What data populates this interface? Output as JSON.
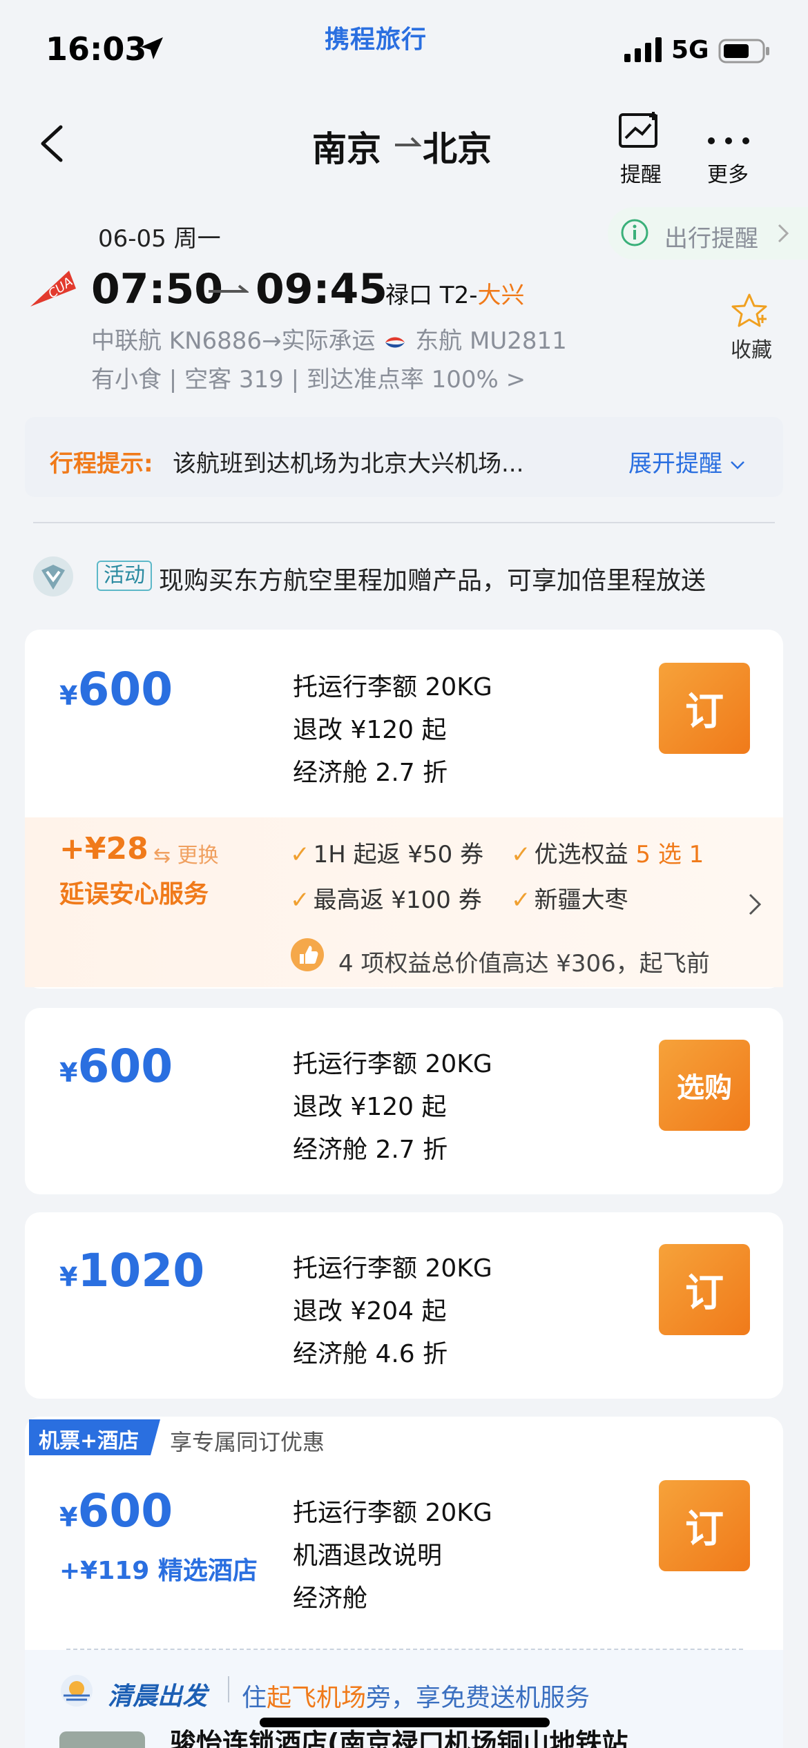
{
  "status": {
    "time": "16:03",
    "brand": "携程旅行",
    "network": "5G"
  },
  "header": {
    "from": "南京",
    "to": "北京",
    "actions": [
      {
        "label": "提醒",
        "icon": "chart-reminder-icon"
      },
      {
        "label": "更多",
        "icon": "more-dots-icon"
      }
    ]
  },
  "flight": {
    "date": "06-05 周一",
    "reminder": "出行提醒",
    "dep_time": "07:50",
    "arr_time": "09:45",
    "airport_from": "禄口 T2-",
    "airport_to": "大兴",
    "favorite": "收藏",
    "operator_line": "中联航 KN6886→实际承运",
    "actual_carrier": "东航 MU2811",
    "info_line": "有小食 | 空客 319 | 到达准点率 100% >",
    "airline_logo_text": "CUA"
  },
  "notice": {
    "label": "行程提示:",
    "text": "该航班到达机场为北京大兴机场...",
    "expand": "展开提醒"
  },
  "activity": {
    "badge": "活动",
    "text": "现购买东方航空里程加赠产品，可享加倍里程放送"
  },
  "fares": [
    {
      "yen": "¥",
      "price": "600",
      "baggage": "托运行李额 20KG",
      "refund": "退改 ¥120 起",
      "cabin": "经济舱 2.7 折",
      "button": "订"
    },
    {
      "yen": "¥",
      "price": "600",
      "baggage": "托运行李额 20KG",
      "refund": "退改 ¥120 起",
      "cabin": "经济舱 2.7 折",
      "button": "选购"
    },
    {
      "yen": "¥",
      "price": "1020",
      "baggage": "托运行李额 20KG",
      "refund": "退改 ¥204 起",
      "cabin": "经济舱 4.6 折",
      "button": "订"
    },
    {
      "yen": "¥",
      "price": "600",
      "baggage": "托运行李额 20KG",
      "refund": "机酒退改说明",
      "cabin": "经济舱",
      "button": "订"
    }
  ],
  "insurance": {
    "price": "+¥28",
    "swap": "⇆ 更换",
    "title": "延误安心服务",
    "benefits": [
      {
        "text": "1H 起返 ¥50 券",
        "highlight": ""
      },
      {
        "text": "优选权益 ",
        "highlight": "5 选 1"
      },
      {
        "text": "最高返 ¥100 券",
        "highlight": ""
      },
      {
        "text": "新疆大枣",
        "highlight": ""
      }
    ],
    "summary": "4 项权益总价值高达 ¥306，起飞前"
  },
  "package": {
    "tag": "机票+酒店",
    "tag_desc": "享专属同订优惠",
    "hotel_addon": "+¥119 精选酒店"
  },
  "morning": {
    "title": "清晨出发",
    "text_pre": "住",
    "text_hl": "起飞机场",
    "text_post": "旁，享免费送机服务",
    "hotel_name": "骏怡连锁酒店(南京禄口机场铜山地铁站"
  },
  "colors": {
    "accent": "#2a6fe0",
    "orange": "#f07a1a",
    "background": "#f2f4f7"
  }
}
